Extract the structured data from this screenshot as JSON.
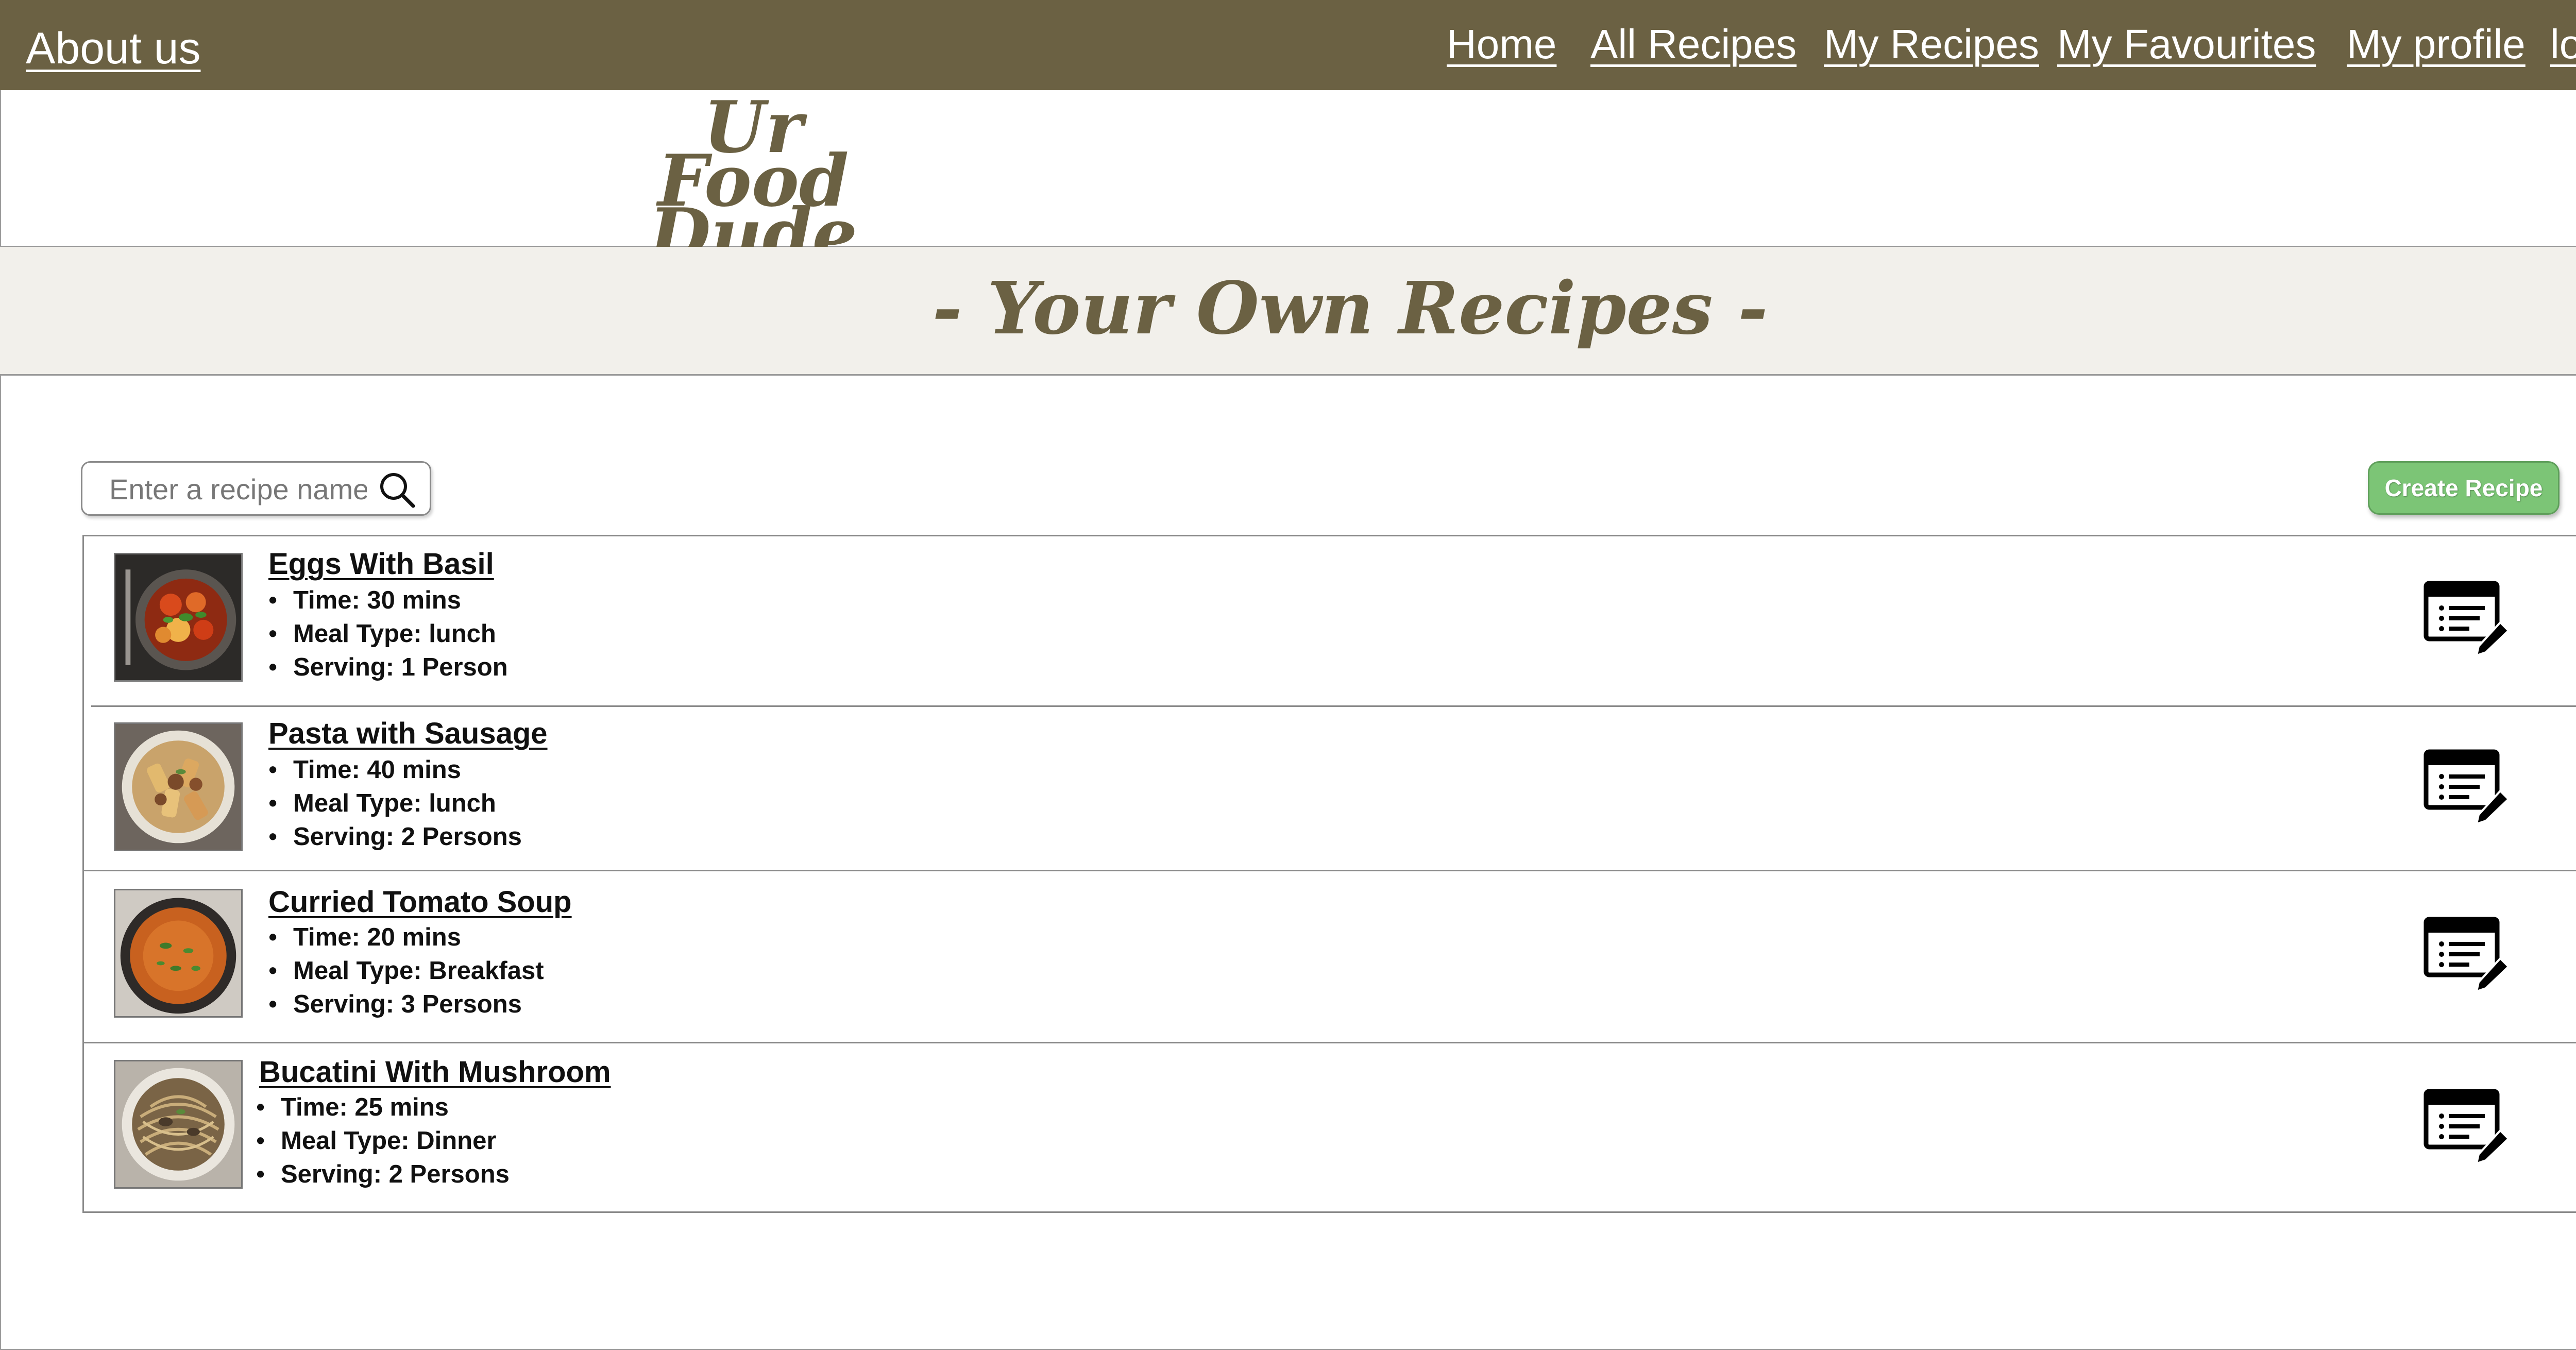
{
  "nav": {
    "about": "About us",
    "home": "Home",
    "all_recipes": "All Recipes",
    "my_recipes": "My Recipes",
    "my_favourites": "My Favourites",
    "my_profile": "My profile",
    "logout": "log out"
  },
  "logo": {
    "line1": "Ur",
    "line2": "Food Dude"
  },
  "page_title": "- Your Own Recipes -",
  "search": {
    "placeholder": "Enter a recipe name...",
    "value": "",
    "icon": "search-icon"
  },
  "create_button": "Create Recipe",
  "colors": {
    "nav_bg": "#6b6143",
    "brand_text": "#6b6143",
    "title_band_bg": "#f2f0eb",
    "create_button_bg": "#7cc576"
  },
  "recipes": [
    {
      "name": "Eggs With Basil",
      "time": "Time: 30  mins",
      "meal": "Meal Type: lunch",
      "serving": "Serving: 1 Person",
      "thumb": "tomato-egg-pan-photo",
      "action_icon": "edit-recipe-icon"
    },
    {
      "name": "Pasta with Sausage",
      "time": "Time: 40  mins",
      "meal": "Meal Type: lunch",
      "serving": "Serving: 2 Persons",
      "thumb": "rigatoni-sausage-photo",
      "action_icon": "edit-recipe-icon"
    },
    {
      "name": "Curried Tomato Soup",
      "time": "Time: 20  mins",
      "meal": "Meal Type: Breakfast",
      "serving": "Serving: 3 Persons",
      "thumb": "tomato-soup-pot-photo",
      "action_icon": "edit-recipe-icon"
    },
    {
      "name": "Bucatini With Mushroom",
      "time": "Time: 25  mins",
      "meal": "Meal Type: Dinner",
      "serving": "Serving: 2 Persons",
      "thumb": "bucatini-mushroom-photo",
      "action_icon": "edit-recipe-icon"
    }
  ]
}
